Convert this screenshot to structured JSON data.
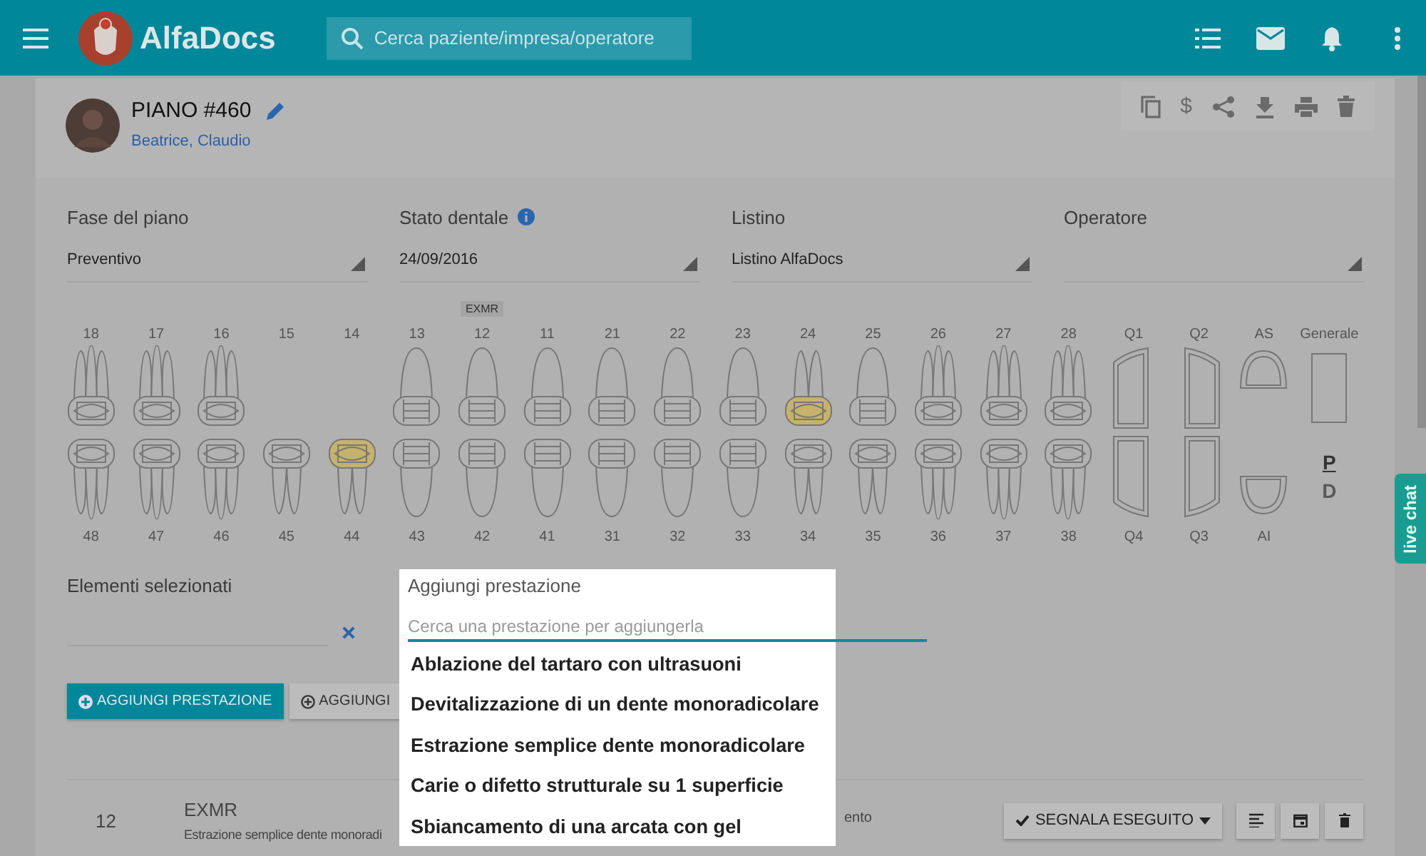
{
  "header": {
    "app_name": "AlfaDocs",
    "search": {
      "placeholder": "Cerca paziente/impresa/operatore"
    }
  },
  "plan": {
    "title": "PIANO #460",
    "patient": "Beatrice, Claudio",
    "toolbar": [
      {
        "kind": "copy"
      },
      {
        "kind": "text",
        "label": "$"
      },
      {
        "kind": "share"
      },
      {
        "kind": "download"
      },
      {
        "kind": "print"
      },
      {
        "kind": "delete"
      }
    ]
  },
  "fields": [
    {
      "label": "Fase del piano",
      "value": "Preventivo"
    },
    {
      "label": "Stato dentale",
      "value": "24/09/2016",
      "info": true
    },
    {
      "label": "Listino",
      "value": "Listino AlfaDocs"
    },
    {
      "label": "Operatore"
    }
  ],
  "teeth": {
    "upper": [
      {
        "label": "18",
        "kind": "molar",
        "highlighted": false
      },
      {
        "label": "17",
        "kind": "molar",
        "highlighted": false
      },
      {
        "label": "16",
        "kind": "molar",
        "highlighted": false
      },
      {
        "label": "15",
        "kind": "empty"
      },
      {
        "label": "14",
        "kind": "empty"
      },
      {
        "label": "13",
        "kind": "single",
        "highlighted": false
      },
      {
        "label": "12",
        "kind": "single",
        "highlighted": false,
        "tag": "EXMR"
      },
      {
        "label": "11",
        "kind": "single",
        "highlighted": false
      },
      {
        "label": "21",
        "kind": "single",
        "highlighted": false
      },
      {
        "label": "22",
        "kind": "single",
        "highlighted": false
      },
      {
        "label": "23",
        "kind": "single",
        "highlighted": false
      },
      {
        "label": "24",
        "kind": "premolar",
        "highlighted": true
      },
      {
        "label": "25",
        "kind": "single",
        "highlighted": false
      },
      {
        "label": "26",
        "kind": "molar",
        "highlighted": false
      },
      {
        "label": "27",
        "kind": "molar",
        "highlighted": false
      },
      {
        "label": "28",
        "kind": "molar",
        "highlighted": false
      },
      {
        "label": "Q1",
        "kind": "quadrant_left"
      },
      {
        "label": "Q2",
        "kind": "quadrant_right"
      },
      {
        "label": "AS",
        "kind": "arch"
      },
      {
        "label": "Generale",
        "kind": "box"
      }
    ],
    "lower": [
      {
        "label": "48",
        "kind": "molar",
        "highlighted": false
      },
      {
        "label": "47",
        "kind": "molar",
        "highlighted": false
      },
      {
        "label": "46",
        "kind": "molar",
        "highlighted": false
      },
      {
        "label": "45",
        "kind": "premolar",
        "highlighted": false
      },
      {
        "label": "44",
        "kind": "premolar",
        "highlighted": true
      },
      {
        "label": "43",
        "kind": "single",
        "highlighted": false
      },
      {
        "label": "42",
        "kind": "single",
        "highlighted": false
      },
      {
        "label": "41",
        "kind": "single",
        "highlighted": false
      },
      {
        "label": "31",
        "kind": "single",
        "highlighted": false
      },
      {
        "label": "32",
        "kind": "single",
        "highlighted": false
      },
      {
        "label": "33",
        "kind": "single",
        "highlighted": false
      },
      {
        "label": "34",
        "kind": "premolar",
        "highlighted": false
      },
      {
        "label": "35",
        "kind": "premolar",
        "highlighted": false
      },
      {
        "label": "36",
        "kind": "molar",
        "highlighted": false
      },
      {
        "label": "37",
        "kind": "molar",
        "highlighted": false
      },
      {
        "label": "38",
        "kind": "molar",
        "highlighted": false
      },
      {
        "label": "Q4",
        "kind": "quadrant_left"
      },
      {
        "label": "Q3",
        "kind": "quadrant_right"
      },
      {
        "label": "AI",
        "kind": "arch"
      }
    ]
  },
  "surface_toggle": [
    {
      "label": "P",
      "selected": true
    },
    {
      "label": "D",
      "selected": false
    }
  ],
  "selected_elements": {
    "label": "Elementi selezionati"
  },
  "buttons": [
    {
      "label": "AGGIUNGI PRESTAZIONE",
      "kind": "primary"
    },
    {
      "label": "AGGIUNGI",
      "kind": "secondary"
    }
  ],
  "treatments": [
    {
      "tooth": "12",
      "code": "EXMR",
      "description": "Estrazione semplice dente monoradi",
      "note": "ento",
      "action": "SEGNALA ESEGUITO"
    }
  ],
  "popup": {
    "title": "Aggiungi prestazione",
    "search_placeholder": "Cerca una prestazione per aggiungerla",
    "options": [
      "Ablazione del tartaro con ultrasuoni",
      "Devitalizzazione di un dente monoradicolare",
      "Estrazione semplice dente monoradicolare",
      "Carie o difetto strutturale su 1 superficie",
      "Sbiancamento di una arcata con gel"
    ]
  },
  "live_chat": "live chat"
}
